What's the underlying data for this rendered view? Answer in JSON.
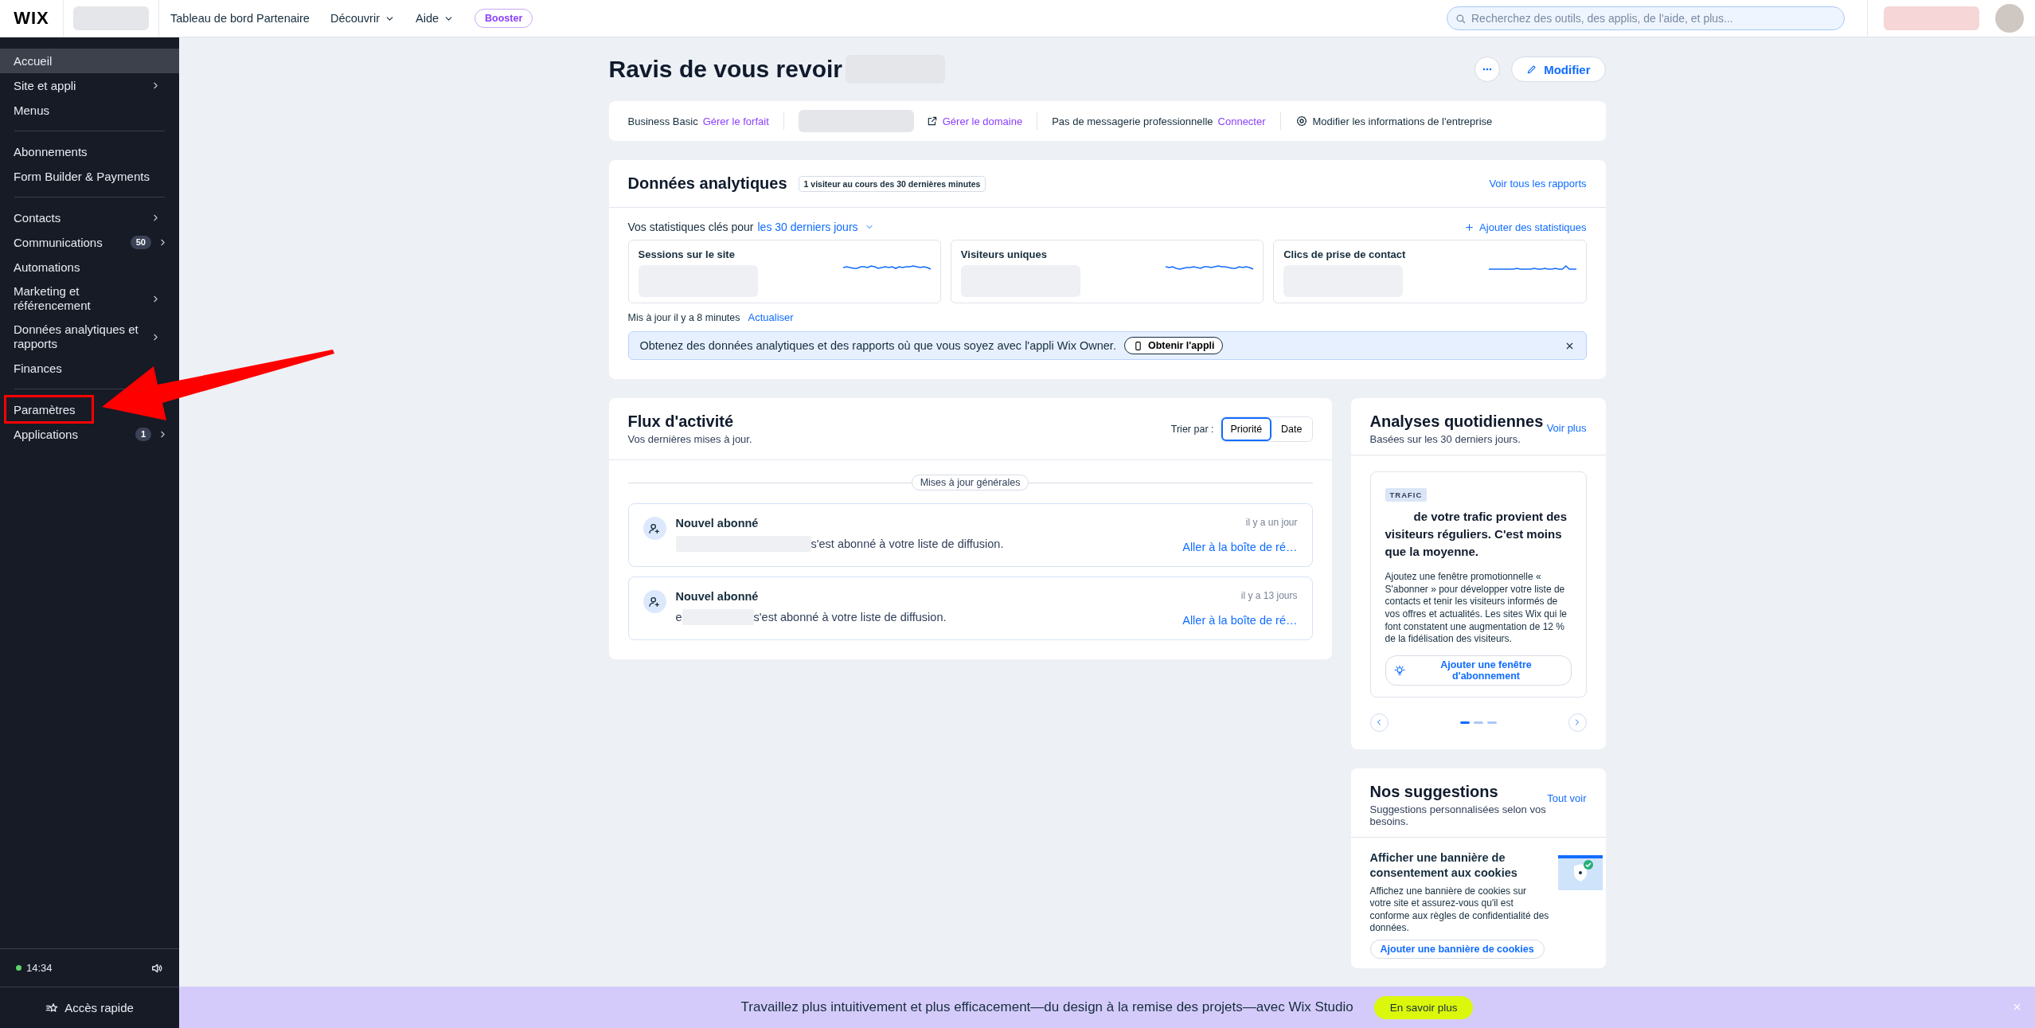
{
  "topbar": {
    "logo": "WIX",
    "nav": [
      {
        "label": "Tableau de bord Partenaire",
        "dropdown": false
      },
      {
        "label": "Découvrir",
        "dropdown": true
      },
      {
        "label": "Aide",
        "dropdown": true
      }
    ],
    "badge": "Booster",
    "search": {
      "placeholder": "Recherchez des outils, des applis, de l'aide, et plus..."
    }
  },
  "sidebar": {
    "groups": [
      [
        {
          "label": "Accueil",
          "selected": true,
          "has_children": false,
          "highlighted": false
        },
        {
          "label": "Site et appli",
          "selected": false,
          "has_children": true,
          "highlighted": false
        },
        {
          "label": "Menus",
          "selected": false,
          "has_children": false,
          "highlighted": false
        }
      ],
      [
        {
          "label": "Abonnements",
          "selected": false,
          "has_children": false,
          "highlighted": false
        },
        {
          "label": "Form Builder & Payments",
          "selected": false,
          "has_children": false,
          "highlighted": false
        }
      ],
      [
        {
          "label": "Contacts",
          "selected": false,
          "has_children": true,
          "highlighted": false
        },
        {
          "label": "Communications",
          "selected": false,
          "has_children": true,
          "highlighted": false,
          "count": "50"
        },
        {
          "label": "Automations",
          "selected": false,
          "has_children": false,
          "highlighted": false
        },
        {
          "label": "Marketing et référencement",
          "selected": false,
          "has_children": true,
          "highlighted": false
        },
        {
          "label": "Données analytiques et rapports",
          "selected": false,
          "has_children": true,
          "highlighted": false
        },
        {
          "label": "Finances",
          "selected": false,
          "has_children": false,
          "highlighted": false
        }
      ],
      [
        {
          "label": "Paramètres",
          "selected": false,
          "has_children": false,
          "highlighted": true
        },
        {
          "label": "Applications",
          "selected": false,
          "has_children": true,
          "highlighted": false,
          "count": "1"
        }
      ]
    ],
    "footer": {
      "time": "14:34",
      "online": true
    },
    "quick_access": "Accès rapide"
  },
  "main": {
    "title": "Ravis de vous revoir",
    "edit_button": "Modifier",
    "info_bar": [
      {
        "kind": "plan",
        "text": "Business Basic",
        "link": "Gérer le forfait"
      },
      {
        "kind": "domain",
        "link": "Gérer le domaine"
      },
      {
        "kind": "mail",
        "text": "Pas de messagerie professionnelle",
        "link": "Connecter"
      },
      {
        "kind": "settings",
        "text": "Modifier les informations de l'entreprise"
      }
    ],
    "analytics": {
      "title": "Données analytiques",
      "live_badge": "1 visiteur au cours des 30 dernières minutes",
      "link": "Voir tous les rapports",
      "period_label": "Vos statistiques clés pour",
      "period": "les 30 derniers jours",
      "add_link": "Ajouter des statistiques",
      "stats": [
        {
          "label": "Sessions sur le site"
        },
        {
          "label": "Visiteurs uniques"
        },
        {
          "label": "Clics de prise de contact"
        }
      ],
      "updated": "Mis à jour il y a 8 minutes",
      "refresh": "Actualiser",
      "promo": {
        "text": "Obtenez des données analytiques et des rapports où que vous soyez avec l'appli Wix Owner.",
        "button": "Obtenir l'appli"
      }
    },
    "activity": {
      "title": "Flux d'activité",
      "subtitle": "Vos dernières mises à jour.",
      "sort_label": "Trier par :",
      "sort_options": [
        {
          "label": "Priorité",
          "selected": true
        },
        {
          "label": "Date",
          "selected": false
        }
      ],
      "section": "Mises à jour générales",
      "items": [
        {
          "title": "Nouvel abonné",
          "text": "s'est abonné à votre liste de diffusion.",
          "time": "il y a un jour",
          "link": "Aller à la boîte de ré…"
        },
        {
          "title": "Nouvel abonné",
          "sender_prefix": "e",
          "text": "s'est abonné à votre liste de diffusion.",
          "time": "il y a 13 jours",
          "link": "Aller à la boîte de ré…"
        }
      ]
    },
    "daily": {
      "title": "Analyses quotidiennes",
      "subtitle": "Basées sur les 30 derniers jours.",
      "link": "Voir plus",
      "tag": "TRAFIC",
      "headline": "de votre trafic provient des visiteurs réguliers. C'est moins que la moyenne.",
      "body": "Ajoutez une fenêtre promotionnelle « S'abonner » pour développer votre liste de contacts et tenir les visiteurs informés de vos offres et actualités. Les sites Wix qui le font constatent une augmentation de 12 % de la fidélisation des visiteurs.",
      "action": "Ajouter une fenêtre d'abonnement",
      "pages": [
        {
          "selected": true
        },
        {
          "selected": false
        },
        {
          "selected": false
        }
      ]
    },
    "suggestions": {
      "title": "Nos suggestions",
      "subtitle": "Suggestions personnalisées selon vos besoins.",
      "link": "Tout voir",
      "item": {
        "title": "Afficher une bannière de consentement aux cookies",
        "body": "Affichez une bannière de cookies sur votre site et assurez-vous qu'il est conforme aux règles de confidentialité des données.",
        "action": "Ajouter une bannière de cookies"
      }
    }
  },
  "banner": {
    "text": "Travaillez plus intuitivement et plus efficacement—du design à la remise des projets—avec Wix Studio",
    "button": "En savoir plus"
  }
}
